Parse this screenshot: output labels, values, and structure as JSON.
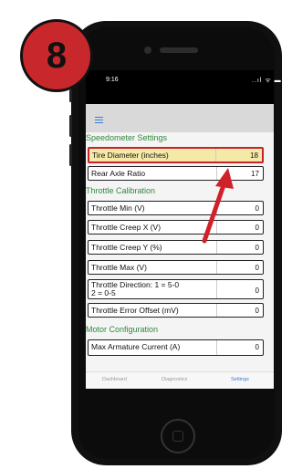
{
  "badge": {
    "number": "8"
  },
  "status_bar": {
    "time": "9:16",
    "icons": "..ıl ᯤ ▬"
  },
  "screen": {
    "sections": [
      {
        "title": "Speedometer Settings",
        "rows": [
          {
            "label": "Tire Diameter (inches)",
            "value": "18",
            "highlighted": true
          },
          {
            "label": "Rear Axle Ratio",
            "value": "17"
          }
        ]
      },
      {
        "title": "Throttle Calibration",
        "rows": [
          {
            "label": "Throttle Min (V)",
            "value": "0"
          },
          {
            "label": "Throttle Creep X (V)",
            "value": "0"
          },
          {
            "label": "Throttle Creep Y (%)",
            "value": "0"
          },
          {
            "label": "Throttle Max (V)",
            "value": "0"
          },
          {
            "label": "Throttle Direction: 1 = 5-0\n2 = 0-5",
            "value": "0"
          },
          {
            "label": "Throttle Error Offset (mV)",
            "value": "0"
          }
        ]
      },
      {
        "title": "Motor Configuration",
        "rows": [
          {
            "label": "Max Armature Current (A)",
            "value": "0"
          }
        ]
      }
    ]
  },
  "tabs": [
    {
      "label": "Dashboard",
      "active": false
    },
    {
      "label": "Diagnostics",
      "active": false
    },
    {
      "label": "Settings",
      "active": true
    }
  ],
  "colors": {
    "highlight_border": "#c8222b",
    "highlight_fill": "#f5e9a8",
    "section_title": "#2f8a3c",
    "accent": "#3a7bd5",
    "badge": "#c8272b",
    "arrow": "#d0212a"
  }
}
